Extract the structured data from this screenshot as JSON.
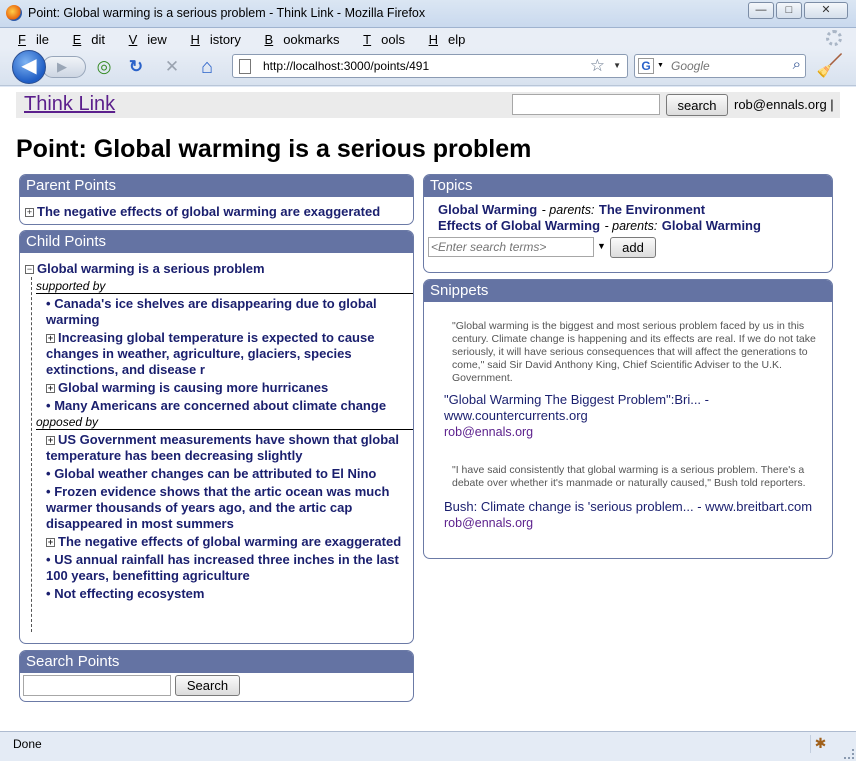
{
  "window": {
    "title": "Point: Global warming is a serious problem - Think Link - Mozilla Firefox",
    "buttons": {
      "minimize": "—",
      "maximize": "□",
      "close": "✕"
    }
  },
  "menu": {
    "items": [
      {
        "label": "File",
        "u": "F",
        "rest": "ile"
      },
      {
        "label": "Edit",
        "u": "E",
        "rest": "dit"
      },
      {
        "label": "View",
        "u": "V",
        "rest": "iew"
      },
      {
        "label": "History",
        "u": "H",
        "rest": "istory"
      },
      {
        "label": "Bookmarks",
        "u": "B",
        "rest": "ookmarks"
      },
      {
        "label": "Tools",
        "u": "T",
        "rest": "ools"
      },
      {
        "label": "Help",
        "u": "H",
        "rest": "elp"
      }
    ]
  },
  "nav": {
    "url": "http://localhost:3000/points/491",
    "search_placeholder": "Google",
    "icons": {
      "back": "◀",
      "forward": "▶",
      "reload": "↻",
      "stop": "✕",
      "home": "⌂",
      "star": "☆",
      "magnifier": "🔍",
      "google": "G"
    }
  },
  "site": {
    "logo": "Think Link",
    "search_button": "search",
    "user": "rob@ennals.org |"
  },
  "page_title": "Point: Global warming is a serious problem",
  "parent_points": {
    "heading": "Parent Points",
    "items": [
      "The negative effects of global warming are exaggerated"
    ]
  },
  "child_points": {
    "heading": "Child Points",
    "root": "Global warming is a serious problem",
    "supported_label": "supported by",
    "supported": [
      {
        "marker": "•",
        "text": "Canada's ice shelves are disappearing due to global warming"
      },
      {
        "marker": "⊞",
        "text": "Increasing global temperature is expected to cause changes in weather, agriculture, glaciers, species extinctions, and disease r"
      },
      {
        "marker": "⊞",
        "text": "Global warming is causing more hurricanes"
      },
      {
        "marker": "•",
        "text": "Many Americans are concerned about climate change"
      }
    ],
    "opposed_label": "opposed by",
    "opposed": [
      {
        "marker": "⊞",
        "text": "US Government measurements have shown that global temperature has been decreasing slightly"
      },
      {
        "marker": "•",
        "text": "Global weather changes can be attributed to El Nino"
      },
      {
        "marker": "•",
        "text": "Frozen evidence shows that the artic ocean was much warmer thousands of years ago, and the artic cap disappeared in most summers"
      },
      {
        "marker": "⊞",
        "text": "The negative effects of global warming are exaggerated"
      },
      {
        "marker": "•",
        "text": "US annual rainfall has increased three inches in the last 100 years, benefitting agriculture"
      },
      {
        "marker": "•",
        "text": "Not effecting ecosystem"
      }
    ]
  },
  "search_points": {
    "heading": "Search Points",
    "button": "Search"
  },
  "topics": {
    "heading": "Topics",
    "parents_label": "- parents:",
    "items": [
      {
        "name": "Global Warming",
        "parent": "The Environment"
      },
      {
        "name": "Effects of Global Warming",
        "parent": "Global Warming"
      }
    ],
    "input_placeholder": "<Enter search terms>",
    "add_button": "add"
  },
  "snippets": {
    "heading": "Snippets",
    "items": [
      {
        "quote": "\"Global warming is the biggest and most serious problem faced by us in this century. Climate change is happening and its effects are real. If we do not take seriously, it will have serious consequences that will affect the generations to come,\" said Sir David Anthony King, Chief Scientific Adviser to the U.K. Government.",
        "source": "\"Global Warming The Biggest Problem\":Bri... - www.countercurrents.org",
        "user": "rob@ennals.org"
      },
      {
        "quote": "\"I have said consistently that global warming is a serious problem. There's a debate over whether it's manmade or naturally caused,\" Bush told reporters.",
        "source": "Bush: Climate change is 'serious problem... - www.breitbart.com",
        "user": "rob@ennals.org"
      }
    ]
  },
  "status": {
    "text": "Done"
  }
}
